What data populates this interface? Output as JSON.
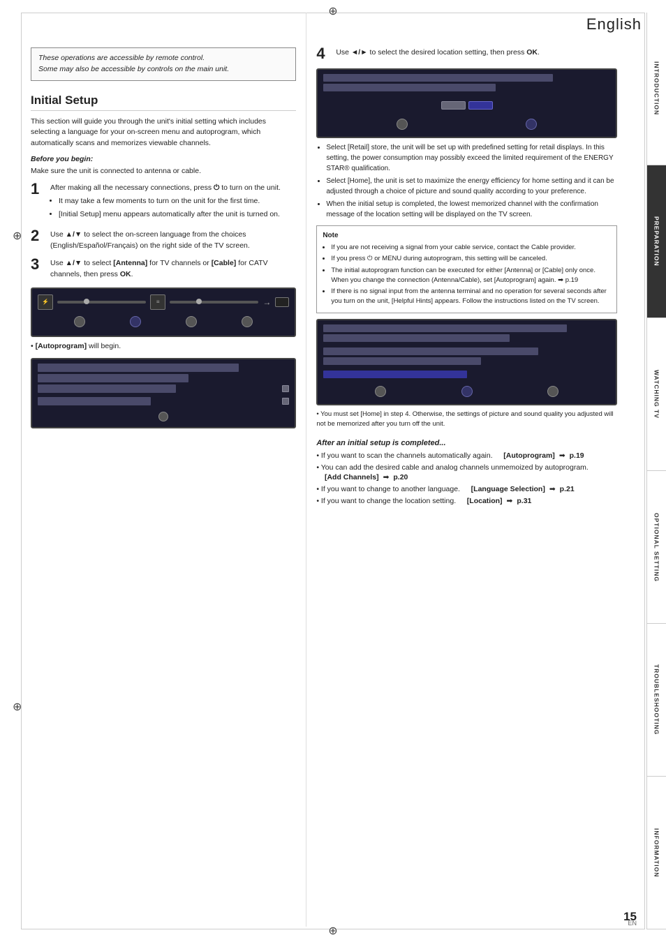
{
  "page": {
    "title": "English",
    "number": "15",
    "lang_code": "EN"
  },
  "notice": {
    "line1": "These operations are accessible by remote control.",
    "line2": "Some may also be accessible by controls on the main unit."
  },
  "sidebar": {
    "tabs": [
      {
        "id": "introduction",
        "label": "INTRODUCTION",
        "active": false
      },
      {
        "id": "preparation",
        "label": "PREPARATION",
        "active": true
      },
      {
        "id": "watching-tv",
        "label": "WATCHING TV",
        "active": false
      },
      {
        "id": "optional-setting",
        "label": "OPTIONAL SETTING",
        "active": false
      },
      {
        "id": "troubleshooting",
        "label": "TROUBLESHOOTING",
        "active": false
      },
      {
        "id": "information",
        "label": "INFORMATION",
        "active": false
      }
    ]
  },
  "initial_setup": {
    "title": "Initial Setup",
    "intro": "This section will guide you through the unit's initial setting which includes selecting a language for your on-screen menu and autoprogram, which automatically scans and memorizes viewable channels.",
    "before_heading": "Before you begin:",
    "before_text": "Make sure the unit is connected to antenna or cable.",
    "steps": [
      {
        "num": "1",
        "text": "After making all the necessary connections, press ⏻ to turn on the unit.",
        "bullets": [
          "It may take a few moments to turn on the unit for the first time.",
          "[Initial Setup] menu appears automatically after the unit is turned on."
        ]
      },
      {
        "num": "2",
        "text": "Use ▲/▼ to select the on-screen language from the choices (English/Español/Français) on the right side of the TV screen."
      },
      {
        "num": "3",
        "text": "Use ▲/▼ to select [Antenna] for TV channels or [Cable] for CATV channels, then press OK.",
        "after_bullet": "[Autoprogram] will begin."
      }
    ],
    "step4": {
      "num": "4",
      "text": "Use ◄/► to select the desired location setting, then press OK."
    },
    "location_bullets": [
      "Select [Retail] store, the unit will be set up with predefined setting for retail displays. In this setting, the power consumption may possibly exceed the limited requirement of the ENERGY STAR® qualification.",
      "Select [Home], the unit is set to maximize the energy efficiency for home setting and it can be adjusted through a choice of picture and sound quality according to your preference.",
      "When the initial setup is completed, the lowest memorized channel with the confirmation message of the location setting will be displayed on the TV screen."
    ],
    "note_title": "Note",
    "notes": [
      "If you are not receiving a signal from your cable service, contact the Cable provider.",
      "If you press ⏻ or MENU during autoprogram, this setting will be canceled.",
      "The initial autoprogram function can be executed for either [Antenna] or [Cable] only once. When you change the connection (Antenna/Cable), set [Autoprogram] again. ➡ p.19",
      "If there is no signal input from the antenna terminal and no operation for several seconds after you turn on the unit, [Helpful Hints] appears. Follow the instructions listed on the TV screen."
    ],
    "home_note": "• You must set [Home] in step 4. Otherwise, the settings of picture and sound quality you adjusted will not be memorized after you turn off the unit."
  },
  "after_setup": {
    "heading": "After an initial setup is completed...",
    "items": [
      {
        "bullet": "If you want to scan the channels automatically again.",
        "label": "[Autoprogram]",
        "arrow": "➡",
        "page": "p.19"
      },
      {
        "bullet": "You can add the desired cable and analog channels unmemoized by autoprogram.",
        "label": "[Add Channels]",
        "arrow": "➡",
        "page": "p.20"
      },
      {
        "bullet": "If you want to change to another language.",
        "label": "[Language Selection]",
        "arrow": "➡",
        "page": "p.21"
      },
      {
        "bullet": "If you want to change the location setting.",
        "label": "[Location]",
        "arrow": "➡",
        "page": "p.31"
      }
    ]
  }
}
